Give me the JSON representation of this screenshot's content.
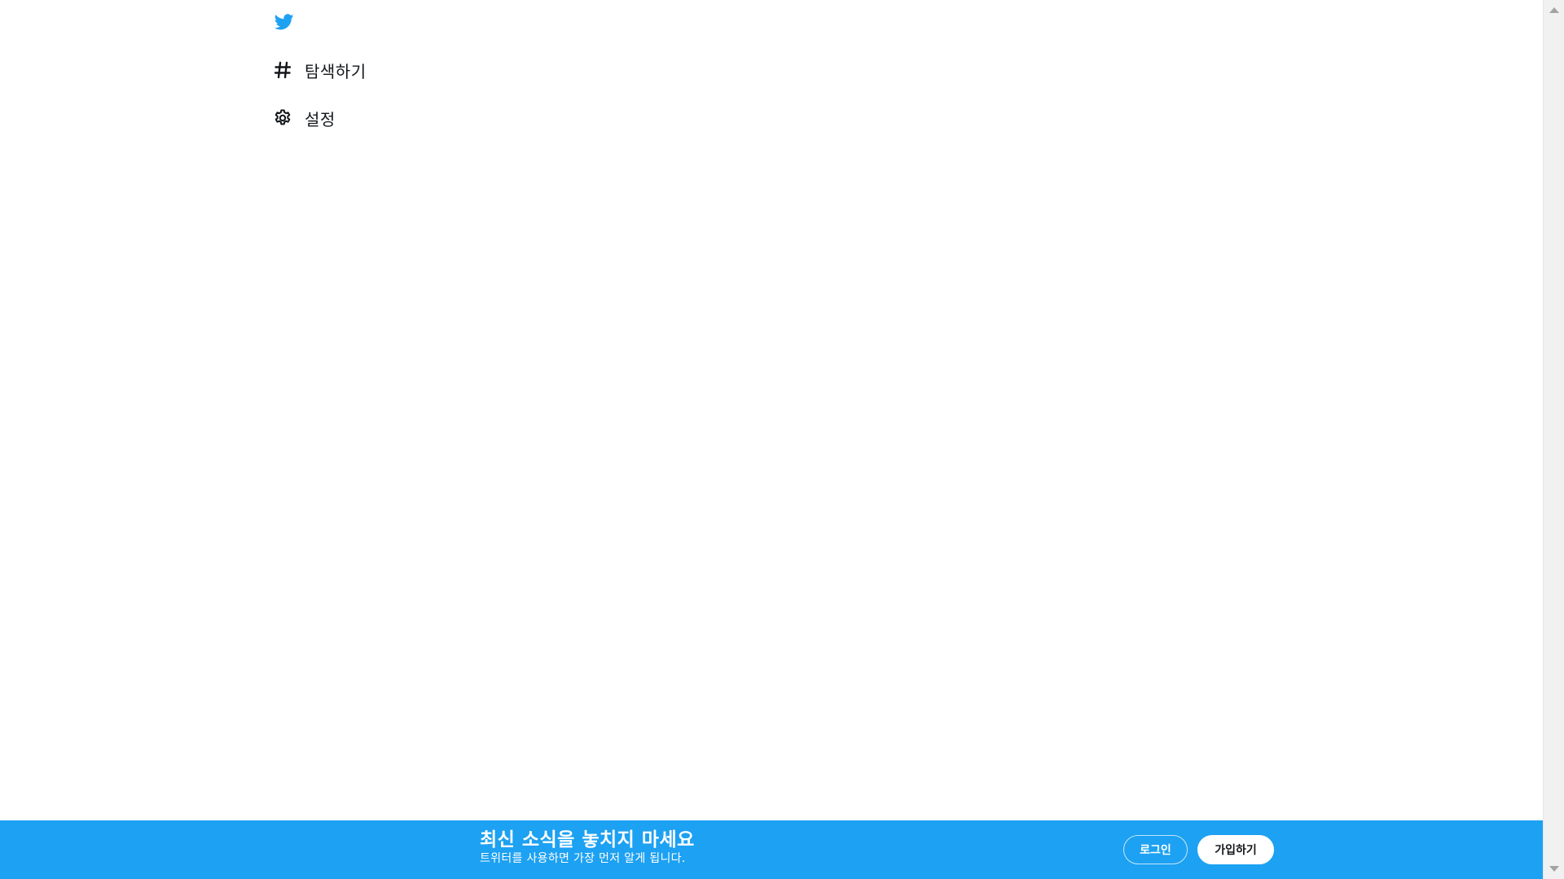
{
  "colors": {
    "brand": "#1da1f2",
    "text": "#14171a",
    "background": "#ffffff"
  },
  "nav": {
    "logo_icon": "twitter-bird-icon",
    "items": [
      {
        "label": "탐색하기",
        "icon": "hashtag-icon"
      },
      {
        "label": "설정",
        "icon": "gear-icon"
      }
    ]
  },
  "banner": {
    "title": "최신 소식을 놓치지 마세요",
    "subtitle": "트위터를 사용하면 가장 먼저 알게 됩니다.",
    "login_label": "로그인",
    "signup_label": "가입하기"
  }
}
